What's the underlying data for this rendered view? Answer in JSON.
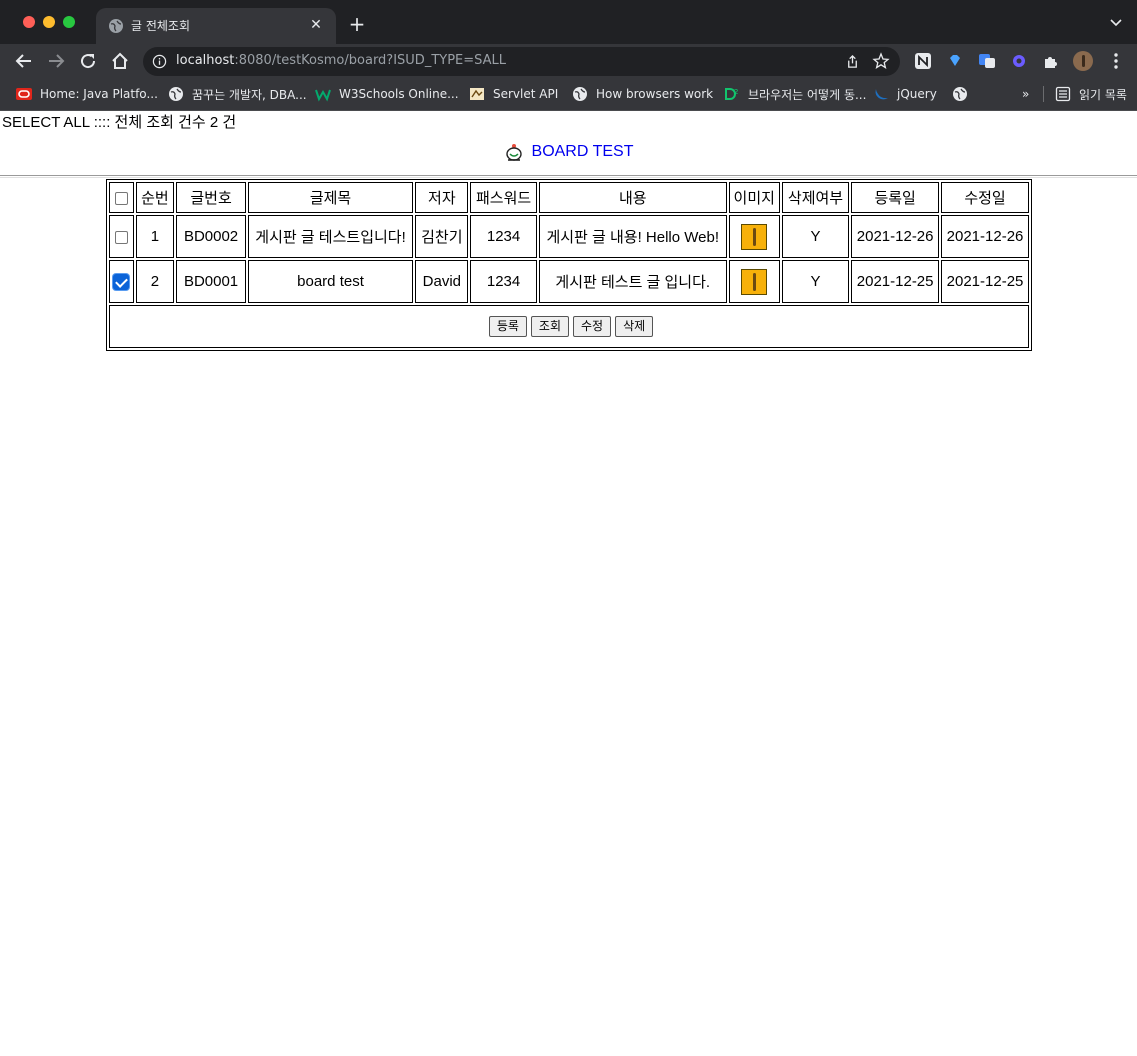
{
  "browser": {
    "tab_title": "글 전체조회",
    "url_host": "localhost",
    "url_rest": ":8080/testKosmo/board?ISUD_TYPE=SALL",
    "bookmarks": [
      {
        "label": "Home: Java Platfo...",
        "icon": "oracle-icon"
      },
      {
        "label": "꿈꾸는 개발자, DBA...",
        "icon": "globe-icon"
      },
      {
        "label": "W3Schools Online...",
        "icon": "w3schools-icon"
      },
      {
        "label": "Servlet API",
        "icon": "servlet-icon"
      },
      {
        "label": "How browsers work",
        "icon": "globe-icon"
      },
      {
        "label": "브라우저는 어떻게 동...",
        "icon": "d2-icon"
      },
      {
        "label": "jQuery",
        "icon": "jquery-icon"
      },
      {
        "label": "",
        "icon": "globe-icon"
      }
    ],
    "more_bookmarks": "»",
    "reading_list": "읽기 목록"
  },
  "page": {
    "summary": "SELECT ALL :::: 전체 조회 건수 2 건",
    "title": "BOARD TEST"
  },
  "table": {
    "headers": [
      "순번",
      "글번호",
      "글제목",
      "저자",
      "패스워드",
      "내용",
      "이미지",
      "삭제여부",
      "등록일",
      "수정일"
    ],
    "rows": [
      {
        "checked": false,
        "no": "1",
        "id": "BD0002",
        "subject": "게시판 글 테스트입니다!",
        "writer": "김찬기",
        "password": "1234",
        "content": "게시판 글 내용! Hello Web!",
        "deleted": "Y",
        "reg_date": "2021-12-26",
        "mod_date": "2021-12-26"
      },
      {
        "checked": true,
        "no": "2",
        "id": "BD0001",
        "subject": "board test",
        "writer": "David",
        "password": "1234",
        "content": "게시판 테스트 글 입니다.",
        "deleted": "Y",
        "reg_date": "2021-12-25",
        "mod_date": "2021-12-25"
      }
    ],
    "buttons": {
      "insert": "등록",
      "select": "조회",
      "update": "수정",
      "delete": "삭제"
    }
  },
  "colors": {
    "link": "#0000ee",
    "checkbox_checked": "#0b63d8",
    "thumbnail": "#f7b10a"
  }
}
